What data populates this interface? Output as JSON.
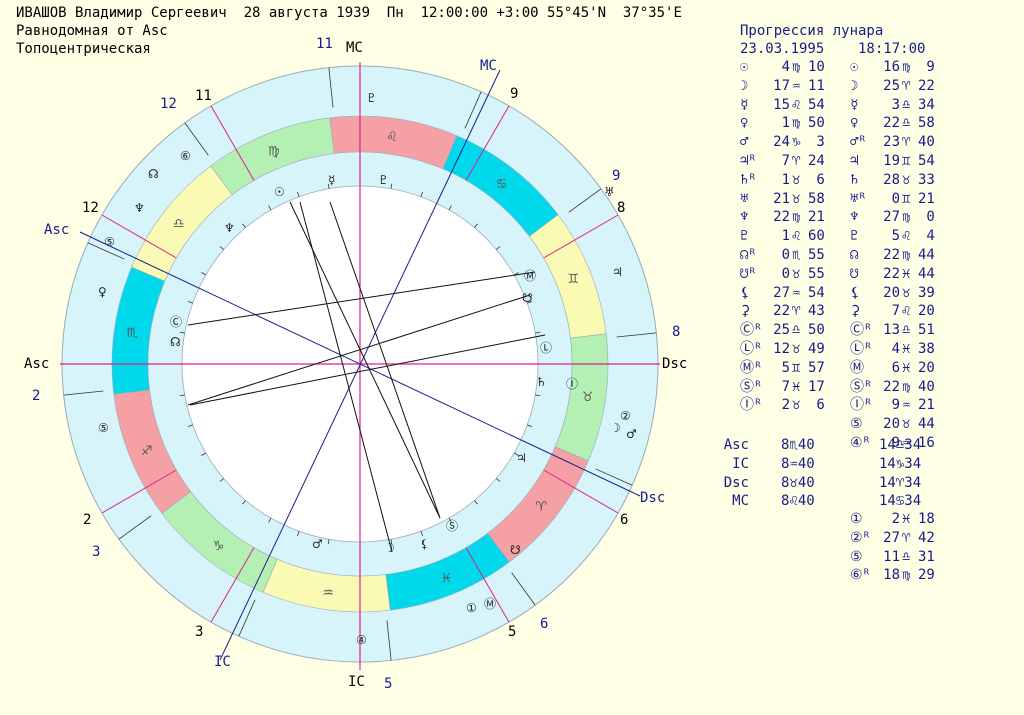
{
  "header": {
    "line1": "ИВАШОВ Владимир Сергеевич  28 августа 1939  Пн  12:00:00 +3:00 55°45'N  37°35'E",
    "line2": "Равнодомная от Asc",
    "line3": "Топоцентрическая"
  },
  "progression": {
    "title": "Прогрессия лунара",
    "date": "23.03.1995",
    "time": "18:17:00"
  },
  "colors": {
    "background": "#ffffe6",
    "outer_ring": "#d6f4fa",
    "zodiac_red": "#f4a0a4",
    "zodiac_cyan": "#00d8ec",
    "zodiac_yellow": "#fafab4",
    "zodiac_green": "#b4f0b4",
    "axis": "#e0208c",
    "text_blue": "#1a1a8c"
  },
  "natal_table": [
    {
      "glyph": "☉",
      "deg": "4",
      "sign": "♍",
      "min": "10"
    },
    {
      "glyph": "☽",
      "deg": "17",
      "sign": "♒",
      "min": "11"
    },
    {
      "glyph": "☿",
      "deg": "15",
      "sign": "♌",
      "min": "54"
    },
    {
      "glyph": "♀",
      "deg": "1",
      "sign": "♍",
      "min": "50"
    },
    {
      "glyph": "♂",
      "deg": "24",
      "sign": "♑",
      "min": " 3"
    },
    {
      "glyph": "♃ᴿ",
      "deg": "7",
      "sign": "♈",
      "min": "24"
    },
    {
      "glyph": "♄ᴿ",
      "deg": "1",
      "sign": "♉",
      "min": " 6"
    },
    {
      "glyph": "♅",
      "deg": "21",
      "sign": "♉",
      "min": "58"
    },
    {
      "glyph": "♆",
      "deg": "22",
      "sign": "♍",
      "min": "21"
    },
    {
      "glyph": "♇",
      "deg": "1",
      "sign": "♌",
      "min": "60"
    },
    {
      "glyph": "☊ᴿ",
      "deg": "0",
      "sign": "♏",
      "min": "55"
    },
    {
      "glyph": "☋ᴿ",
      "deg": "0",
      "sign": "♉",
      "min": "55"
    },
    {
      "glyph": "⚸",
      "deg": "27",
      "sign": "♒",
      "min": "54"
    },
    {
      "glyph": "⚳",
      "deg": "22",
      "sign": "♈",
      "min": "43"
    },
    {
      "glyph": "Ⓒᴿ",
      "deg": "25",
      "sign": "♎",
      "min": "50"
    },
    {
      "glyph": "Ⓛᴿ",
      "deg": "12",
      "sign": "♉",
      "min": "49"
    },
    {
      "glyph": "Ⓜᴿ",
      "deg": "5",
      "sign": "♊",
      "min": "57"
    },
    {
      "glyph": "Ⓢᴿ",
      "deg": "7",
      "sign": "♓",
      "min": "17"
    },
    {
      "glyph": "Ⓘᴿ",
      "deg": "2",
      "sign": "♉",
      "min": " 6"
    }
  ],
  "progressed_table": [
    {
      "glyph": "☉",
      "deg": "16",
      "sign": "♍",
      "min": " 9"
    },
    {
      "glyph": "☽",
      "deg": "25",
      "sign": "♈",
      "min": "22"
    },
    {
      "glyph": "☿",
      "deg": "3",
      "sign": "♎",
      "min": "34"
    },
    {
      "glyph": "♀",
      "deg": "22",
      "sign": "♎",
      "min": "58"
    },
    {
      "glyph": "♂ᴿ",
      "deg": "23",
      "sign": "♈",
      "min": "40"
    },
    {
      "glyph": "♃",
      "deg": "19",
      "sign": "♊",
      "min": "54"
    },
    {
      "glyph": "♄",
      "deg": "28",
      "sign": "♉",
      "min": "33"
    },
    {
      "glyph": "♅ᴿ",
      "deg": "0",
      "sign": "♊",
      "min": "21"
    },
    {
      "glyph": "♆",
      "deg": "27",
      "sign": "♍",
      "min": " 0"
    },
    {
      "glyph": "♇",
      "deg": "5",
      "sign": "♌",
      "min": " 4"
    },
    {
      "glyph": "☊",
      "deg": "22",
      "sign": "♍",
      "min": "44"
    },
    {
      "glyph": "☋",
      "deg": "22",
      "sign": "♓",
      "min": "44"
    },
    {
      "glyph": "⚸",
      "deg": "20",
      "sign": "♉",
      "min": "39"
    },
    {
      "glyph": "⚳",
      "deg": "7",
      "sign": "♌",
      "min": "20"
    },
    {
      "glyph": "Ⓒᴿ",
      "deg": "13",
      "sign": "♎",
      "min": "51"
    },
    {
      "glyph": "Ⓛᴿ",
      "deg": "4",
      "sign": "♓",
      "min": "38"
    },
    {
      "glyph": "Ⓜ",
      "deg": "6",
      "sign": "♓",
      "min": "20"
    },
    {
      "glyph": "Ⓢᴿ",
      "deg": "22",
      "sign": "♍",
      "min": "40"
    },
    {
      "glyph": "Ⓘᴿ",
      "deg": "9",
      "sign": "♒",
      "min": "21"
    },
    {
      "glyph": "⑤",
      "deg": "20",
      "sign": "♉",
      "min": "44"
    },
    {
      "glyph": "④ᴿ",
      "deg": "9",
      "sign": "♒",
      "min": "16"
    }
  ],
  "angles": [
    {
      "label": "Asc",
      "natal": "8♏40",
      "prog": "14♎34"
    },
    {
      "label": "IC",
      "natal": "8♒40",
      "prog": "14♑34"
    },
    {
      "label": "Dsc",
      "natal": "8♉40",
      "prog": "14♈34"
    },
    {
      "label": "MC",
      "natal": "8♌40",
      "prog": "14♋34"
    }
  ],
  "extra_points": [
    {
      "glyph": "①",
      "deg": "2",
      "sign": "♓",
      "min": "18"
    },
    {
      "glyph": "②ᴿ",
      "deg": "27",
      "sign": "♈",
      "min": "42"
    },
    {
      "glyph": "⑤",
      "deg": "11",
      "sign": "♎",
      "min": "31"
    },
    {
      "glyph": "⑥ᴿ",
      "deg": "18",
      "sign": "♍",
      "min": "29"
    }
  ],
  "wheel": {
    "zodiac_glyphs": [
      "♌",
      "♋",
      "♊",
      "♉",
      "♈",
      "♓",
      "♒",
      "♑",
      "♐",
      "♏",
      "♎",
      "♍"
    ],
    "axis_labels": {
      "mc": "MC",
      "ic": "IC",
      "asc": "Asc",
      "dsc": "Dsc"
    },
    "outer_house_numbers_black": [
      "11",
      "9",
      "8",
      "6",
      "5",
      "3",
      "2",
      "12"
    ],
    "outer_house_numbers_blue": [
      "11",
      "12",
      "9",
      "8",
      "6",
      "5",
      "3",
      "2"
    ],
    "prog_axis_labels": {
      "mc": "MC",
      "ic": "IC",
      "asc": "Asc",
      "dsc": "Dsc"
    }
  }
}
